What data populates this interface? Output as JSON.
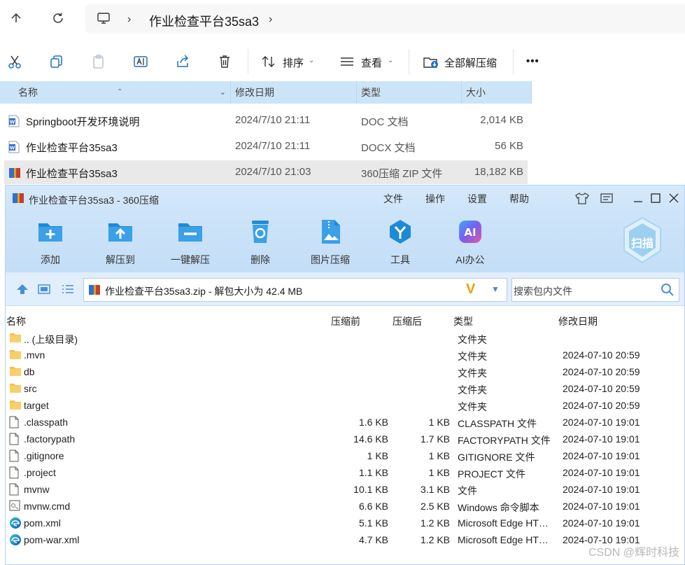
{
  "explorer": {
    "breadcrumb": {
      "folder": "作业检查平台35sa3"
    },
    "commands": {
      "sort_label": "排序",
      "view_label": "查看",
      "extract_all_label": "全部解压缩",
      "more_label": "•••"
    },
    "columns": {
      "name": "名称",
      "modified": "修改日期",
      "type": "类型",
      "size": "大小"
    },
    "files": [
      {
        "name": "Springboot开发环境说明",
        "modified": "2024/7/10 21:11",
        "type": "DOC 文档",
        "size": "2,014 KB",
        "icon": "word-doc-icon"
      },
      {
        "name": "作业检查平台35sa3",
        "modified": "2024/7/10 21:11",
        "type": "DOCX 文档",
        "size": "56 KB",
        "icon": "word-docx-icon"
      },
      {
        "name": "作业检查平台35sa3",
        "modified": "2024/7/10 21:03",
        "type": "360压缩 ZIP 文件",
        "size": "18,182 KB",
        "icon": "zip-archive-icon",
        "selected": true
      }
    ]
  },
  "zip_window": {
    "title": "作业检查平台35sa3 - 360压缩",
    "menu": [
      "文件",
      "操作",
      "设置",
      "帮助"
    ],
    "tools": [
      {
        "label": "添加",
        "icon": "add-folder-icon"
      },
      {
        "label": "解压到",
        "icon": "extract-to-icon"
      },
      {
        "label": "一键解压",
        "icon": "one-click-extract-icon"
      },
      {
        "label": "删除",
        "icon": "recycle-bin-icon"
      },
      {
        "label": "图片压缩",
        "icon": "image-compress-icon"
      },
      {
        "label": "工具",
        "icon": "tools-icon"
      },
      {
        "label": "AI办公",
        "icon": "ai-office-icon"
      }
    ],
    "scan_label": "扫描",
    "path": "作业检查平台35sa3.zip - 解包大小为 42.4 MB",
    "search_placeholder": "搜索包内文件",
    "columns": {
      "name": "名称",
      "compressed_before": "压缩前",
      "compressed_after": "压缩后",
      "type": "类型",
      "modified": "修改日期"
    },
    "entries": [
      {
        "name": ".. (上级目录)",
        "before": "",
        "after": "",
        "type": "文件夹",
        "modified": "",
        "icon": "folder"
      },
      {
        "name": ".mvn",
        "before": "",
        "after": "",
        "type": "文件夹",
        "modified": "2024-07-10 20:59",
        "icon": "folder"
      },
      {
        "name": "db",
        "before": "",
        "after": "",
        "type": "文件夹",
        "modified": "2024-07-10 20:59",
        "icon": "folder"
      },
      {
        "name": "src",
        "before": "",
        "after": "",
        "type": "文件夹",
        "modified": "2024-07-10 20:59",
        "icon": "folder"
      },
      {
        "name": "target",
        "before": "",
        "after": "",
        "type": "文件夹",
        "modified": "2024-07-10 20:59",
        "icon": "folder"
      },
      {
        "name": ".classpath",
        "before": "1.6 KB",
        "after": "1 KB",
        "type": "CLASSPATH 文件",
        "modified": "2024-07-10 19:01",
        "icon": "file"
      },
      {
        "name": ".factorypath",
        "before": "14.6 KB",
        "after": "1.7 KB",
        "type": "FACTORYPATH 文件",
        "modified": "2024-07-10 19:01",
        "icon": "file"
      },
      {
        "name": ".gitignore",
        "before": "1 KB",
        "after": "1 KB",
        "type": "GITIGNORE 文件",
        "modified": "2024-07-10 19:01",
        "icon": "file"
      },
      {
        "name": ".project",
        "before": "1.1 KB",
        "after": "1 KB",
        "type": "PROJECT 文件",
        "modified": "2024-07-10 19:01",
        "icon": "file"
      },
      {
        "name": "mvnw",
        "before": "10.1 KB",
        "after": "3.1 KB",
        "type": "文件",
        "modified": "2024-07-10 19:01",
        "icon": "file"
      },
      {
        "name": "mvnw.cmd",
        "before": "6.6 KB",
        "after": "2.5 KB",
        "type": "Windows 命令脚本",
        "modified": "2024-07-10 19:01",
        "icon": "cmd"
      },
      {
        "name": "pom.xml",
        "before": "5.1 KB",
        "after": "1.2 KB",
        "type": "Microsoft Edge HT…",
        "modified": "2024-07-10 19:01",
        "icon": "edge"
      },
      {
        "name": "pom-war.xml",
        "before": "4.7 KB",
        "after": "1.2 KB",
        "type": "Microsoft Edge HT…",
        "modified": "2024-07-10 19:01",
        "icon": "edge"
      }
    ]
  },
  "watermark": "CSDN @辉时科技",
  "colors": {
    "header_selected": "#cce4f7",
    "window_border": "#b5d4f1",
    "tool_blue": "#1e8ad6",
    "zip_v_orange": "#f0a000"
  }
}
